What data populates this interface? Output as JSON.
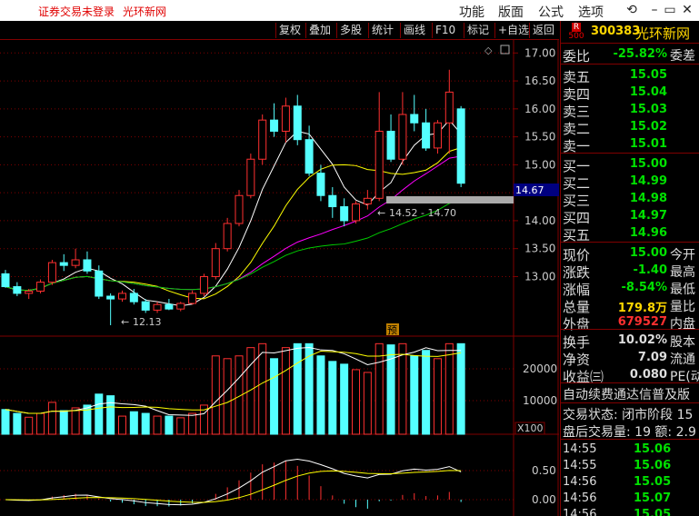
{
  "titlebar": {
    "login_status": "证券交易未登录",
    "stock_name": "光环新网",
    "menus": [
      "功能",
      "版面",
      "公式",
      "选项"
    ]
  },
  "toolbar": {
    "buttons": [
      "复权",
      "叠加",
      "多股",
      "统计",
      "画线",
      "F10",
      "标记",
      "+自选",
      "返回"
    ]
  },
  "chart": {
    "price_ticks": [
      "17.00",
      "16.50",
      "16.00",
      "15.50",
      "15.00",
      "14.50",
      "14.00",
      "13.50",
      "13.00"
    ],
    "current_price_tag": "14.67",
    "low_annotation": "12.13",
    "range_annotation": "14.52 - 14.70",
    "forecast_marker": "预",
    "volume_ticks": [
      "20000",
      "10000"
    ],
    "volume_unit": "X100",
    "macd_ticks": [
      "0.50",
      "0.00"
    ]
  },
  "chart_data": {
    "type": "candlestick",
    "ohlc": [
      [
        13.05,
        13.12,
        12.8,
        12.82
      ],
      [
        12.82,
        12.9,
        12.65,
        12.7
      ],
      [
        12.7,
        12.78,
        12.6,
        12.74
      ],
      [
        12.74,
        12.95,
        12.7,
        12.9
      ],
      [
        12.9,
        13.3,
        12.85,
        13.25
      ],
      [
        13.25,
        13.4,
        13.1,
        13.2
      ],
      [
        13.2,
        13.5,
        13.15,
        13.3
      ],
      [
        13.3,
        13.45,
        13.05,
        13.1
      ],
      [
        13.1,
        13.2,
        12.6,
        12.65
      ],
      [
        12.65,
        12.7,
        12.13,
        12.6
      ],
      [
        12.6,
        12.75,
        12.55,
        12.7
      ],
      [
        12.7,
        12.78,
        12.5,
        12.55
      ],
      [
        12.55,
        12.6,
        12.35,
        12.4
      ],
      [
        12.4,
        12.55,
        12.35,
        12.5
      ],
      [
        12.5,
        12.6,
        12.4,
        12.42
      ],
      [
        12.42,
        12.55,
        12.38,
        12.52
      ],
      [
        12.52,
        12.75,
        12.5,
        12.7
      ],
      [
        12.7,
        13.05,
        12.65,
        13.0
      ],
      [
        13.0,
        13.6,
        12.95,
        13.5
      ],
      [
        13.5,
        14.05,
        13.45,
        13.95
      ],
      [
        13.95,
        14.55,
        13.9,
        14.45
      ],
      [
        14.45,
        15.2,
        14.4,
        15.1
      ],
      [
        15.1,
        15.9,
        15.0,
        15.8
      ],
      [
        15.8,
        16.1,
        15.5,
        15.6
      ],
      [
        15.6,
        16.2,
        15.4,
        16.05
      ],
      [
        16.05,
        16.25,
        15.35,
        15.45
      ],
      [
        15.45,
        15.7,
        14.8,
        14.85
      ],
      [
        14.85,
        15.0,
        14.35,
        14.45
      ],
      [
        14.45,
        14.6,
        14.05,
        14.25
      ],
      [
        14.25,
        14.4,
        13.9,
        14.0
      ],
      [
        14.0,
        14.35,
        13.95,
        14.3
      ],
      [
        14.3,
        14.55,
        14.2,
        14.4
      ],
      [
        14.4,
        16.3,
        14.35,
        15.6
      ],
      [
        15.6,
        15.9,
        15.05,
        15.1
      ],
      [
        15.1,
        16.3,
        15.0,
        15.9
      ],
      [
        15.9,
        16.25,
        15.6,
        15.75
      ],
      [
        15.75,
        16.0,
        15.25,
        15.3
      ],
      [
        15.3,
        15.8,
        15.2,
        15.75
      ],
      [
        15.75,
        16.7,
        15.2,
        16.3
      ],
      [
        16.0,
        16.05,
        14.6,
        14.67
      ]
    ],
    "ylim": [
      12.0,
      17.2
    ],
    "volume_ylim": [
      0,
      24000
    ]
  },
  "quote": {
    "code": "300383",
    "name": "光环新网",
    "badge": "R\n500",
    "weibi": {
      "label": "委比",
      "value": "-25.82%",
      "label2": "委差"
    },
    "sells": [
      {
        "label": "卖五",
        "price": "15.05"
      },
      {
        "label": "卖四",
        "price": "15.04"
      },
      {
        "label": "卖三",
        "price": "15.03"
      },
      {
        "label": "卖二",
        "price": "15.02"
      },
      {
        "label": "卖一",
        "price": "15.01"
      }
    ],
    "buys": [
      {
        "label": "买一",
        "price": "15.00"
      },
      {
        "label": "买二",
        "price": "14.99"
      },
      {
        "label": "买三",
        "price": "14.98"
      },
      {
        "label": "买四",
        "price": "14.97"
      },
      {
        "label": "买五",
        "price": "14.96"
      }
    ],
    "stats": [
      {
        "label": "现价",
        "value": "15.00",
        "label2": "今开",
        "color": "#00e000"
      },
      {
        "label": "涨跌",
        "value": "-1.40",
        "label2": "最高",
        "color": "#00e000"
      },
      {
        "label": "涨幅",
        "value": "-8.54%",
        "label2": "最低",
        "color": "#00e000"
      },
      {
        "label": "总量",
        "value": "179.8万",
        "label2": "量比",
        "color": "#ffd700"
      },
      {
        "label": "外盘",
        "value": "679527",
        "label2": "内盘",
        "color": "#ff3030"
      }
    ],
    "stats2": [
      {
        "label": "换手",
        "value": "10.02%",
        "label2": "股本"
      },
      {
        "label": "净资",
        "value": "7.09",
        "label2": "流通"
      },
      {
        "label": "收益㈢",
        "value": "0.080",
        "label2": "PE(动"
      }
    ],
    "notice": "自动续费通达信普及版",
    "trade_status": "交易状态: 闭市阶段 15",
    "after_hours": "盘后交易量: 19  额: 2.9",
    "ticks": [
      {
        "time": "14:55",
        "price": "15.06"
      },
      {
        "time": "14:55",
        "price": "15.06"
      },
      {
        "time": "14:56",
        "price": "15.05"
      },
      {
        "time": "14:56",
        "price": "15.07"
      },
      {
        "time": "14:56",
        "price": "15.05"
      }
    ]
  }
}
